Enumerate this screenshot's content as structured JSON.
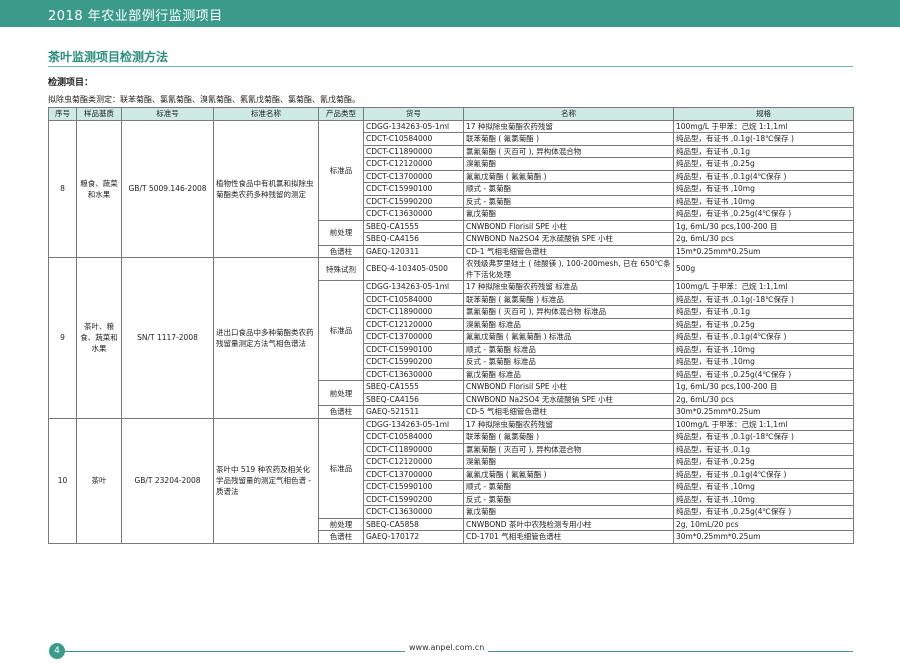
{
  "header": {
    "title": "2018 年农业部例行监测项目"
  },
  "section": {
    "title": "茶叶监测项目检测方法",
    "sub": "检测项目：",
    "intro": "拟除虫菊酯类测定：联苯菊酯、氯氰菊酯、溴氰菊酯、氟氰戊菊酯、氯菊酯、氰戊菊酯。"
  },
  "table": {
    "headers": [
      "序号",
      "样品基质",
      "标准号",
      "标准名称",
      "产品类型",
      "货号",
      "名称",
      "规格"
    ],
    "groups": [
      {
        "no": "8",
        "matrix": "粮食、蔬菜和水果",
        "std_no": "GB/T 5009.146-2008",
        "std_name": "植物性食品中有机氯和拟除虫菊酯类农药多种残留的测定",
        "types": [
          {
            "type": "标准品",
            "rows": [
              [
                "CDGG-134263-05-1ml",
                "17 种拟除虫菊酯农药残留",
                "100mg/L 于甲苯：己烷 1:1,1ml"
              ],
              [
                "CDCT-C10584000",
                "联苯菊酯 ( 氟氯菊酯 )",
                "纯品型，有证书 ,0.1g(-18℃保存 )"
              ],
              [
                "CDCT-C11890000",
                "氯氰菊酯 ( 灭百可 ), 异构体混合物",
                "纯品型，有证书 ,0.1g"
              ],
              [
                "CDCT-C12120000",
                "溴氰菊酯",
                "纯品型，有证书 ,0.25g"
              ],
              [
                "CDCT-C13700000",
                "氟氰戊菊酯 ( 氟氰菊酯 )",
                "纯品型，有证书 ,0.1g(4℃保存 )"
              ],
              [
                "CDCT-C15990100",
                "顺式 - 氯菊酯",
                "纯品型，有证书 ,10mg"
              ],
              [
                "CDCT-C15990200",
                "反式 - 氯菊酯",
                "纯品型，有证书 ,10mg"
              ],
              [
                "CDCT-C13630000",
                "氰戊菊酯",
                "纯品型，有证书 ,0.25g(4℃保存 )"
              ]
            ]
          },
          {
            "type": "前处理",
            "rows": [
              [
                "SBEQ-CA1555",
                "CNWBOND Florisil SPE 小柱",
                "1g, 6mL/30 pcs,100-200 目"
              ],
              [
                "SBEQ-CA4156",
                "CNWBOND Na2SO4 无水硫酸钠 SPE 小柱",
                "2g, 6mL/30 pcs"
              ]
            ]
          },
          {
            "type": "色谱柱",
            "rows": [
              [
                "GAEQ-120311",
                "CD-1 气相毛细管色谱柱",
                "15m*0.25mm*0.25um"
              ]
            ]
          }
        ]
      },
      {
        "no": "9",
        "matrix": "茶叶、粮食、蔬菜和水果",
        "std_no": "SN/T 1117-2008",
        "std_name": "进出口食品中多种菊酯类农药残留量测定方法气相色谱法",
        "types": [
          {
            "type": "特殊试剂",
            "rows": [
              [
                "CBEQ-4-103405-0500",
                "农残级弗罗里硅土 ( 硅酸镁 ), 100-200mesh, 已在 650℃条件下活化处理",
                "500g"
              ]
            ]
          },
          {
            "type": "标准品",
            "rows": [
              [
                "CDGG-134263-05-1ml",
                "17 种拟除虫菊酯农药残留 标准品",
                "100mg/L 于甲苯：己烷 1:1,1ml"
              ],
              [
                "CDCT-C10584000",
                "联苯菊酯 ( 氟氯菊酯 ) 标准品",
                "纯品型，有证书 ,0.1g(-18℃保存 )"
              ],
              [
                "CDCT-C11890000",
                "氯氰菊酯 ( 灭百可 ), 异构体混合物 标准品",
                "纯品型，有证书 ,0.1g"
              ],
              [
                "CDCT-C12120000",
                "溴氰菊酯 标准品",
                "纯品型，有证书 ,0.25g"
              ],
              [
                "CDCT-C13700000",
                "氟氰戊菊酯 ( 氟氰菊酯 ) 标准品",
                "纯品型，有证书 ,0.1g(4℃保存 )"
              ],
              [
                "CDCT-C15990100",
                "顺式 - 氯菊酯 标准品",
                "纯品型，有证书 ,10mg"
              ],
              [
                "CDCT-C15990200",
                "反式 - 氯菊酯 标准品",
                "纯品型，有证书 ,10mg"
              ],
              [
                "CDCT-C13630000",
                "氰戊菊酯 标准品",
                "纯品型，有证书 ,0.25g(4℃保存 )"
              ]
            ]
          },
          {
            "type": "前处理",
            "rows": [
              [
                "SBEQ-CA1555",
                "CNWBOND Florisil SPE 小柱",
                "1g, 6mL/30 pcs,100-200 目"
              ],
              [
                "SBEQ-CA4156",
                "CNWBOND Na2SO4 无水硫酸钠 SPE 小柱",
                "2g, 6mL/30 pcs"
              ]
            ]
          },
          {
            "type": "色谱柱",
            "rows": [
              [
                "GAEQ-521511",
                "CD-5 气相毛细管色谱柱",
                "30m*0.25mm*0.25um"
              ]
            ]
          }
        ]
      },
      {
        "no": "10",
        "matrix": "茶叶",
        "std_no": "GB/T 23204-2008",
        "std_name": "茶叶中 519 种农药及相关化学品残留量的测定气相色谱 - 质谱法",
        "types": [
          {
            "type": "标准品",
            "rows": [
              [
                "CDGG-134263-05-1ml",
                "17 种拟除虫菊酯农药残留",
                "100mg/L 于甲苯：己烷 1:1,1ml"
              ],
              [
                "CDCT-C10584000",
                "联苯菊酯 ( 氟氯菊酯 )",
                "纯品型，有证书 ,0.1g(-18℃保存 )"
              ],
              [
                "CDCT-C11890000",
                "氯氰菊酯 ( 灭百可 ), 异构体混合物",
                "纯品型，有证书 ,0.1g"
              ],
              [
                "CDCT-C12120000",
                "溴氰菊酯",
                "纯品型，有证书 ,0.25g"
              ],
              [
                "CDCT-C13700000",
                "氟氰戊菊酯 ( 氟氰菊酯 )",
                "纯品型，有证书 ,0.1g(4℃保存 )"
              ],
              [
                "CDCT-C15990100",
                "顺式 - 氯菊酯",
                "纯品型，有证书 ,10mg"
              ],
              [
                "CDCT-C15990200",
                "反式 - 氯菊酯",
                "纯品型，有证书 ,10mg"
              ],
              [
                "CDCT-C13630000",
                "氰戊菊酯",
                "纯品型，有证书 ,0.25g(4℃保存 )"
              ]
            ]
          },
          {
            "type": "前处理",
            "rows": [
              [
                "SBEQ-CA5858",
                "CNWBOND 茶叶中农残检测专用小柱",
                "2g, 10mL/20 pcs"
              ]
            ]
          },
          {
            "type": "色谱柱",
            "rows": [
              [
                "GAEQ-170172",
                "CD-1701 气相毛细管色谱柱",
                "30m*0.25mm*0.25um"
              ]
            ]
          }
        ]
      }
    ]
  },
  "footer": {
    "page": "4",
    "url": "www.anpel.com.cn"
  }
}
